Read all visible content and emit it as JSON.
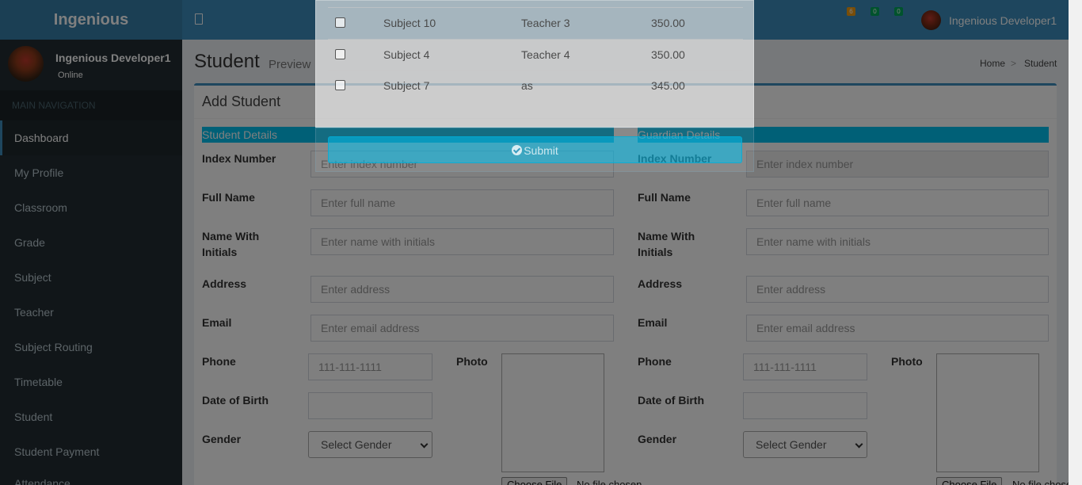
{
  "header": {
    "logo": "Ingenious",
    "badges": [
      "6",
      "0",
      "0"
    ],
    "user_name": "Ingenious Developer1"
  },
  "sidebar": {
    "user_name": "Ingenious Developer1",
    "status": "Online",
    "nav_header": "MAIN NAVIGATION",
    "items": [
      {
        "label": "Dashboard"
      },
      {
        "label": "My Profile"
      },
      {
        "label": "Classroom"
      },
      {
        "label": "Grade"
      },
      {
        "label": "Subject"
      },
      {
        "label": "Teacher"
      },
      {
        "label": "Subject Routing"
      },
      {
        "label": "Timetable"
      },
      {
        "label": "Student"
      },
      {
        "label": "Student Payment"
      },
      {
        "label": "Attendance"
      }
    ]
  },
  "page": {
    "title": "Student",
    "subtitle": "Preview",
    "breadcrumb": [
      "Home",
      ">",
      "Student"
    ],
    "box_title": "Add Student"
  },
  "student": {
    "section": "Student Details",
    "index_label": "Index Number",
    "index_placeholder": "Enter index number",
    "fullname_label": "Full Name",
    "fullname_placeholder": "Enter full name",
    "initials_label_1": "Name With",
    "initials_label_2": "Initials",
    "initials_placeholder": "Enter name with initials",
    "address_label": "Address",
    "address_placeholder": "Enter address",
    "email_label": "Email",
    "email_placeholder": "Enter email address",
    "phone_label": "Phone",
    "phone_placeholder": "111-111-1111",
    "photo_label": "Photo",
    "dob_label": "Date of Birth",
    "gender_label": "Gender",
    "gender_value": "Select Gender",
    "file_button": "Choose File",
    "file_text": "No file chosen"
  },
  "guardian": {
    "section": "Guardian Details",
    "index_label": "Index Number",
    "index_placeholder": "Enter index number",
    "fullname_label": "Full Name",
    "fullname_placeholder": "Enter full name",
    "initials_label_1": "Name With",
    "initials_label_2": "Initials",
    "initials_placeholder": "Enter name with initials",
    "address_label": "Address",
    "address_placeholder": "Enter address",
    "email_label": "Email",
    "email_placeholder": "Enter email address",
    "phone_label": "Phone",
    "phone_placeholder": "111-111-1111",
    "photo_label": "Photo",
    "dob_label": "Date of Birth",
    "gender_label": "Gender",
    "gender_value": "Select Gender",
    "file_button": "Choose File",
    "file_text": "No file chosen"
  },
  "modal": {
    "rows": [
      {
        "subject": "Subject 10",
        "teacher": "Teacher 3",
        "amount": "350.00"
      },
      {
        "subject": "Subject 4",
        "teacher": "Teacher 4",
        "amount": "350.00"
      },
      {
        "subject": "Subject 7",
        "teacher": "as",
        "amount": "345.00"
      }
    ],
    "submit_label": "Submit"
  },
  "colors": {
    "header": "#3c8dbc",
    "logo_bg": "#367fa9",
    "sidebar": "#222d32",
    "section_bar": "#00c0ef"
  }
}
